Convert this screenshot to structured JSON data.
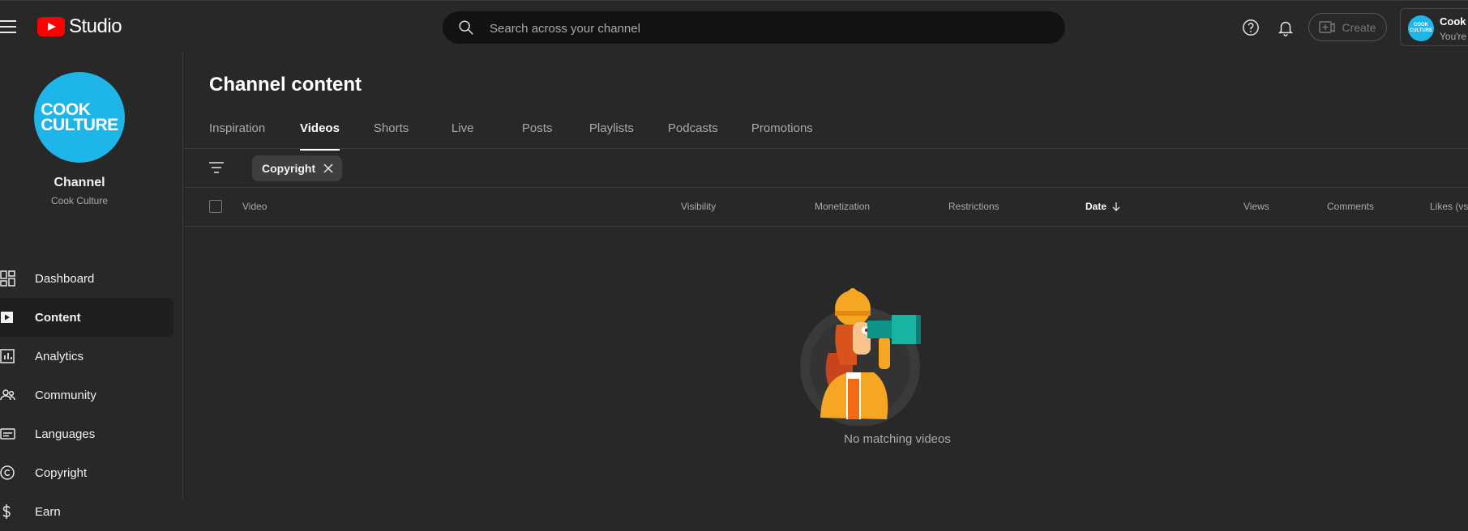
{
  "header": {
    "logo_text": "Studio",
    "search_placeholder": "Search across your channel",
    "create_label": "Create",
    "account": {
      "avatar_text": "COOK CULTURE",
      "name": "Cook Culture",
      "subtitle": "You're viewing as Cook Culture"
    }
  },
  "sidebar": {
    "avatar_text_line1": "COOK",
    "avatar_text_line2": "CULTURE",
    "channel_title": "Channel",
    "channel_name": "Cook Culture",
    "items": [
      {
        "label": "Dashboard",
        "icon": "dashboard-icon",
        "active": false
      },
      {
        "label": "Content",
        "icon": "content-icon",
        "active": true
      },
      {
        "label": "Analytics",
        "icon": "analytics-icon",
        "active": false
      },
      {
        "label": "Community",
        "icon": "community-icon",
        "active": false
      },
      {
        "label": "Languages",
        "icon": "languages-icon",
        "active": false
      },
      {
        "label": "Copyright",
        "icon": "copyright-icon",
        "active": false
      },
      {
        "label": "Earn",
        "icon": "earn-icon",
        "active": false
      }
    ]
  },
  "main": {
    "title": "Channel content",
    "tabs": [
      {
        "label": "Inspiration",
        "active": false
      },
      {
        "label": "Videos",
        "active": true
      },
      {
        "label": "Shorts",
        "active": false
      },
      {
        "label": "Live",
        "active": false
      },
      {
        "label": "Posts",
        "active": false
      },
      {
        "label": "Playlists",
        "active": false
      },
      {
        "label": "Podcasts",
        "active": false
      },
      {
        "label": "Promotions",
        "active": false
      }
    ],
    "filter_chip": "Copyright",
    "columns": {
      "video": "Video",
      "visibility": "Visibility",
      "monetization": "Monetization",
      "restrictions": "Restrictions",
      "date": "Date",
      "views": "Views",
      "comments": "Comments",
      "likes": "Likes (vs. dislikes)"
    },
    "empty_message": "No matching videos"
  },
  "colors": {
    "background": "#282828",
    "accent_avatar": "#1eb5e8",
    "brand_red": "#ff0000"
  }
}
